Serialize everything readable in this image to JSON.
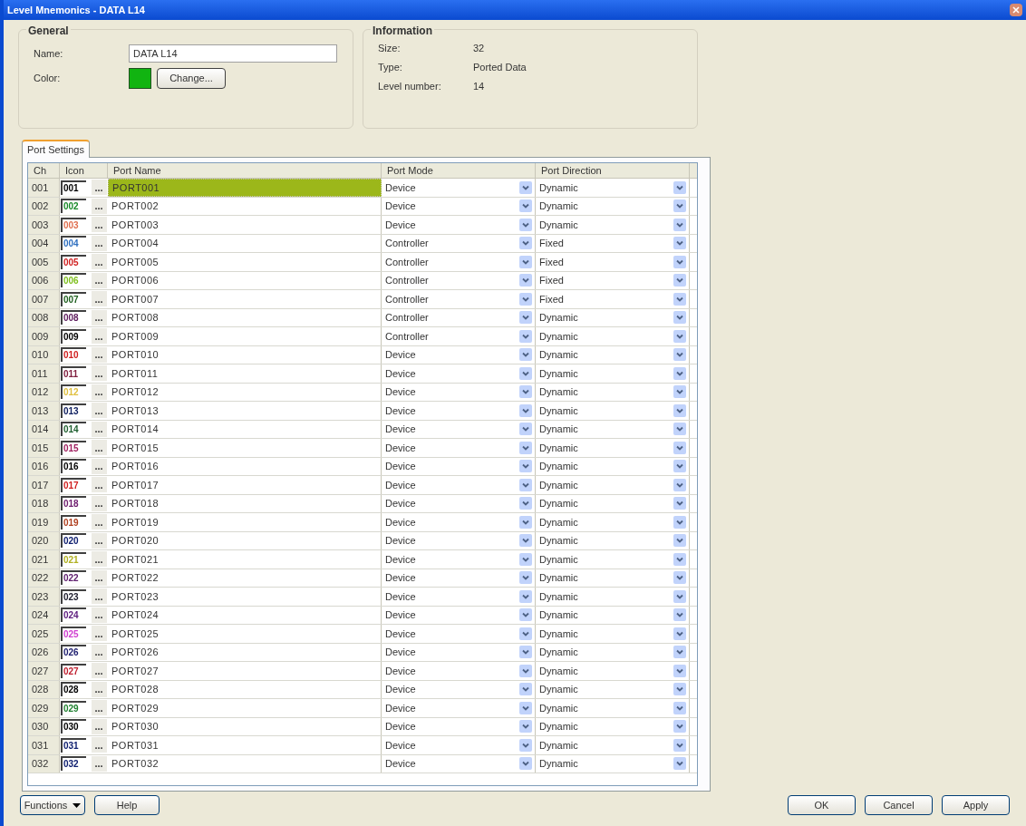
{
  "window": {
    "title": "Level Mnemonics - DATA L14"
  },
  "general": {
    "title": "General",
    "name_label": "Name:",
    "name_value": "DATA L14",
    "color_label": "Color:",
    "color": "#11b411",
    "change_button": "Change..."
  },
  "information": {
    "title": "Information",
    "fields": [
      {
        "label": "Size:",
        "value": "32"
      },
      {
        "label": "Type:",
        "value": "Ported Data"
      },
      {
        "label": "Level number:",
        "value": "14"
      }
    ]
  },
  "tabs": [
    {
      "label": "Port Settings",
      "selected": true
    }
  ],
  "table": {
    "columns": [
      "Ch",
      "Icon",
      "Port Name",
      "Port Mode",
      "Port Direction"
    ],
    "rows": [
      {
        "ch": "001",
        "icon": "001",
        "color": "#000000",
        "browse_button": "...",
        "port_name": "PORT001",
        "port_mode": "Device",
        "port_direction": "Dynamic",
        "selected": true
      },
      {
        "ch": "002",
        "icon": "002",
        "color": "#1a8a2a",
        "browse_button": "...",
        "port_name": "PORT002",
        "port_mode": "Device",
        "port_direction": "Dynamic",
        "selected": false
      },
      {
        "ch": "003",
        "icon": "003",
        "color": "#e07050",
        "browse_button": "...",
        "port_name": "PORT003",
        "port_mode": "Device",
        "port_direction": "Dynamic",
        "selected": false
      },
      {
        "ch": "004",
        "icon": "004",
        "color": "#3070c0",
        "browse_button": "...",
        "port_name": "PORT004",
        "port_mode": "Controller",
        "port_direction": "Fixed",
        "selected": false
      },
      {
        "ch": "005",
        "icon": "005",
        "color": "#d02020",
        "browse_button": "...",
        "port_name": "PORT005",
        "port_mode": "Controller",
        "port_direction": "Fixed",
        "selected": false
      },
      {
        "ch": "006",
        "icon": "006",
        "color": "#80c020",
        "browse_button": "...",
        "port_name": "PORT006",
        "port_mode": "Controller",
        "port_direction": "Fixed",
        "selected": false
      },
      {
        "ch": "007",
        "icon": "007",
        "color": "#206020",
        "browse_button": "...",
        "port_name": "PORT007",
        "port_mode": "Controller",
        "port_direction": "Fixed",
        "selected": false
      },
      {
        "ch": "008",
        "icon": "008",
        "color": "#602060",
        "browse_button": "...",
        "port_name": "PORT008",
        "port_mode": "Controller",
        "port_direction": "Dynamic",
        "selected": false
      },
      {
        "ch": "009",
        "icon": "009",
        "color": "#000000",
        "browse_button": "...",
        "port_name": "PORT009",
        "port_mode": "Controller",
        "port_direction": "Dynamic",
        "selected": false
      },
      {
        "ch": "010",
        "icon": "010",
        "color": "#d02020",
        "browse_button": "...",
        "port_name": "PORT010",
        "port_mode": "Device",
        "port_direction": "Dynamic",
        "selected": false
      },
      {
        "ch": "011",
        "icon": "011",
        "color": "#802040",
        "browse_button": "...",
        "port_name": "PORT011",
        "port_mode": "Device",
        "port_direction": "Dynamic",
        "selected": false
      },
      {
        "ch": "012",
        "icon": "012",
        "color": "#e0c040",
        "browse_button": "...",
        "port_name": "PORT012",
        "port_mode": "Device",
        "port_direction": "Dynamic",
        "selected": false
      },
      {
        "ch": "013",
        "icon": "013",
        "color": "#102060",
        "browse_button": "...",
        "port_name": "PORT013",
        "port_mode": "Device",
        "port_direction": "Dynamic",
        "selected": false
      },
      {
        "ch": "014",
        "icon": "014",
        "color": "#206030",
        "browse_button": "...",
        "port_name": "PORT014",
        "port_mode": "Device",
        "port_direction": "Dynamic",
        "selected": false
      },
      {
        "ch": "015",
        "icon": "015",
        "color": "#a02060",
        "browse_button": "...",
        "port_name": "PORT015",
        "port_mode": "Device",
        "port_direction": "Dynamic",
        "selected": false
      },
      {
        "ch": "016",
        "icon": "016",
        "color": "#000000",
        "browse_button": "...",
        "port_name": "PORT016",
        "port_mode": "Device",
        "port_direction": "Dynamic",
        "selected": false
      },
      {
        "ch": "017",
        "icon": "017",
        "color": "#d02020",
        "browse_button": "...",
        "port_name": "PORT017",
        "port_mode": "Device",
        "port_direction": "Dynamic",
        "selected": false
      },
      {
        "ch": "018",
        "icon": "018",
        "color": "#702070",
        "browse_button": "...",
        "port_name": "PORT018",
        "port_mode": "Device",
        "port_direction": "Dynamic",
        "selected": false
      },
      {
        "ch": "019",
        "icon": "019",
        "color": "#b04020",
        "browse_button": "...",
        "port_name": "PORT019",
        "port_mode": "Device",
        "port_direction": "Dynamic",
        "selected": false
      },
      {
        "ch": "020",
        "icon": "020",
        "color": "#102070",
        "browse_button": "...",
        "port_name": "PORT020",
        "port_mode": "Device",
        "port_direction": "Dynamic",
        "selected": false
      },
      {
        "ch": "021",
        "icon": "021",
        "color": "#b0b020",
        "browse_button": "...",
        "port_name": "PORT021",
        "port_mode": "Device",
        "port_direction": "Dynamic",
        "selected": false
      },
      {
        "ch": "022",
        "icon": "022",
        "color": "#602070",
        "browse_button": "...",
        "port_name": "PORT022",
        "port_mode": "Device",
        "port_direction": "Dynamic",
        "selected": false
      },
      {
        "ch": "023",
        "icon": "023",
        "color": "#202030",
        "browse_button": "...",
        "port_name": "PORT023",
        "port_mode": "Device",
        "port_direction": "Dynamic",
        "selected": false
      },
      {
        "ch": "024",
        "icon": "024",
        "color": "#602080",
        "browse_button": "...",
        "port_name": "PORT024",
        "port_mode": "Device",
        "port_direction": "Dynamic",
        "selected": false
      },
      {
        "ch": "025",
        "icon": "025",
        "color": "#d040d0",
        "browse_button": "...",
        "port_name": "PORT025",
        "port_mode": "Device",
        "port_direction": "Dynamic",
        "selected": false
      },
      {
        "ch": "026",
        "icon": "026",
        "color": "#202070",
        "browse_button": "...",
        "port_name": "PORT026",
        "port_mode": "Device",
        "port_direction": "Dynamic",
        "selected": false
      },
      {
        "ch": "027",
        "icon": "027",
        "color": "#c02030",
        "browse_button": "...",
        "port_name": "PORT027",
        "port_mode": "Device",
        "port_direction": "Dynamic",
        "selected": false
      },
      {
        "ch": "028",
        "icon": "028",
        "color": "#000000",
        "browse_button": "...",
        "port_name": "PORT028",
        "port_mode": "Device",
        "port_direction": "Dynamic",
        "selected": false
      },
      {
        "ch": "029",
        "icon": "029",
        "color": "#208030",
        "browse_button": "...",
        "port_name": "PORT029",
        "port_mode": "Device",
        "port_direction": "Dynamic",
        "selected": false
      },
      {
        "ch": "030",
        "icon": "030",
        "color": "#000000",
        "browse_button": "...",
        "port_name": "PORT030",
        "port_mode": "Device",
        "port_direction": "Dynamic",
        "selected": false
      },
      {
        "ch": "031",
        "icon": "031",
        "color": "#102070",
        "browse_button": "...",
        "port_name": "PORT031",
        "port_mode": "Device",
        "port_direction": "Dynamic",
        "selected": false
      },
      {
        "ch": "032",
        "icon": "032",
        "color": "#102070",
        "browse_button": "...",
        "port_name": "PORT032",
        "port_mode": "Device",
        "port_direction": "Dynamic",
        "selected": false
      }
    ]
  },
  "footer": {
    "left_buttons": [
      {
        "label": "Functions",
        "kind": "dropdown"
      },
      {
        "label": "Help",
        "kind": "plain"
      }
    ],
    "right_buttons": [
      "OK",
      "Cancel",
      "Apply"
    ]
  }
}
